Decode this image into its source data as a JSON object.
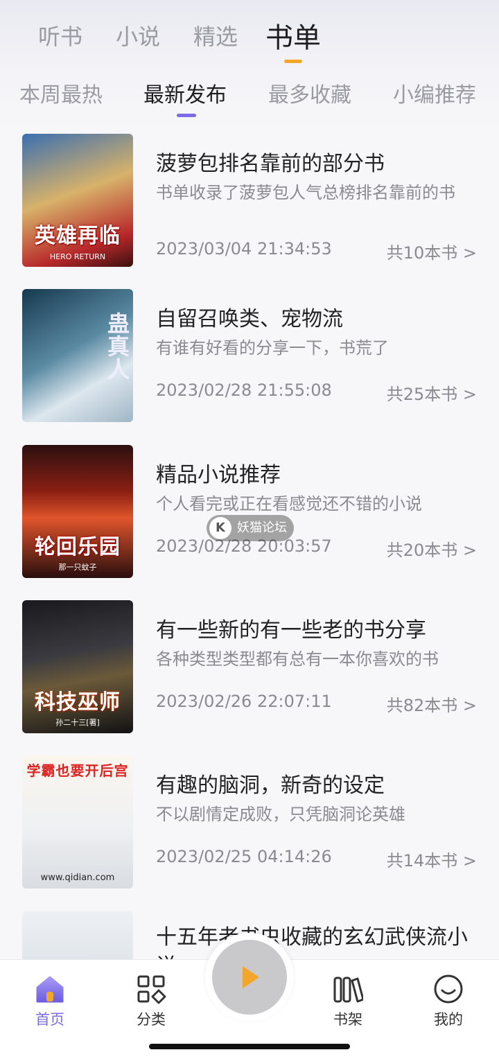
{
  "main_tabs": [
    {
      "label": "听书"
    },
    {
      "label": "小说"
    },
    {
      "label": "精选"
    },
    {
      "label": "书单"
    }
  ],
  "sub_tabs": [
    {
      "label": "本周最热"
    },
    {
      "label": "最新发布"
    },
    {
      "label": "最多收藏"
    },
    {
      "label": "小编推荐"
    }
  ],
  "booklists": [
    {
      "title": "菠萝包排名靠前的部分书",
      "desc": "书单收录了菠萝包人气总榜排名靠前的书",
      "date": "2023/03/04 21:34:53",
      "count": "共10本书 >",
      "cover_text": "英雄再临",
      "cover_sub": "HERO RETURN"
    },
    {
      "title": "自留召唤类、宠物流",
      "desc": "有谁有好看的分享一下，书荒了",
      "date": "2023/02/28 21:55:08",
      "count": "共25本书 >",
      "cover_text": "蛊真人",
      "cover_sub": ""
    },
    {
      "title": "精品小说推荐",
      "desc": "个人看完或正在看感觉还不错的小说",
      "date": "2023/02/28 20:03:57",
      "count": "共20本书 >",
      "cover_text": "轮回乐园",
      "cover_sub": "那一只蚊子"
    },
    {
      "title": "有一些新的有一些老的书分享",
      "desc": "各种类型类型都有总有一本你喜欢的书",
      "date": "2023/02/26 22:07:11",
      "count": "共82本书 >",
      "cover_text": "科技巫师",
      "cover_sub": "孙二十三[著]"
    },
    {
      "title": "有趣的脑洞，新奇的设定",
      "desc": "不以剧情定成败，只凭脑洞论英雄",
      "date": "2023/02/25 04:14:26",
      "count": "共14本书 >",
      "cover_text": "学霸也要开后宫",
      "cover_sub": "www.qidian.com"
    },
    {
      "title": "十五年老书虫收藏的玄幻武侠流小说",
      "desc": "",
      "date": "",
      "count": "",
      "cover_text": "",
      "cover_sub": ""
    }
  ],
  "watermark": {
    "text": "妖猫论坛"
  },
  "bottom_nav": [
    {
      "label": "首页"
    },
    {
      "label": "分类"
    },
    {
      "label": "书架"
    },
    {
      "label": "我的"
    }
  ],
  "colors": {
    "accent": "#7b6be6",
    "tab_indicator": "#f4a62a",
    "play": "#f4a62a"
  },
  "icons": [
    "home-icon",
    "category-icon",
    "play-icon",
    "bookshelf-icon",
    "profile-icon"
  ]
}
